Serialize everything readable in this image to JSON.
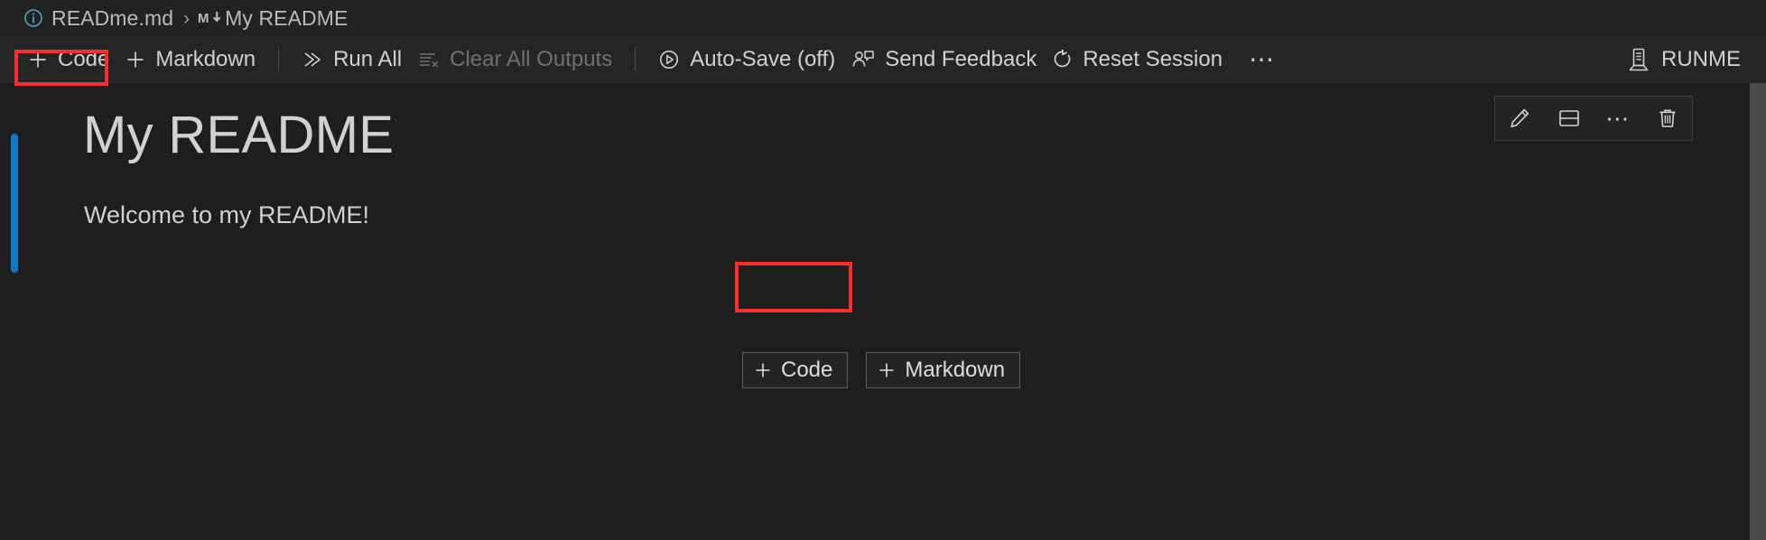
{
  "breadcrumb": {
    "info_icon": "info-circle-icon",
    "file": "READme.md",
    "separator": "›",
    "markdown_icon": "markdown-icon",
    "section": "My README"
  },
  "toolbar": {
    "add_code_label": "Code",
    "add_markdown_label": "Markdown",
    "run_all_label": "Run All",
    "clear_all_outputs_label": "Clear All Outputs",
    "autosave_label": "Auto-Save (off)",
    "send_feedback_label": "Send Feedback",
    "reset_session_label": "Reset Session",
    "overflow_label": "⋯",
    "kernel_label": "RUNME"
  },
  "cell": {
    "title": "My README",
    "paragraph": "Welcome to my README!"
  },
  "inline_add": {
    "code_label": "Code",
    "markdown_label": "Markdown"
  },
  "cell_toolbar": {
    "edit_title": "Edit Cell",
    "split_title": "Split Cell",
    "more_label": "⋯",
    "delete_title": "Delete Cell"
  },
  "annotations": {
    "highlight_color": "#fb2c2c",
    "targets": [
      "toolbar-add-code-button",
      "inline-add-code-button"
    ]
  },
  "theme": {
    "background": "#1e1e1e",
    "toolbar_background": "#252526",
    "breadcrumb_background": "#222222",
    "foreground": "#cccccc",
    "disabled_foreground": "#6e7071",
    "selection_bar": "#0a7aca",
    "scrollbar": "#4a4a4a"
  }
}
